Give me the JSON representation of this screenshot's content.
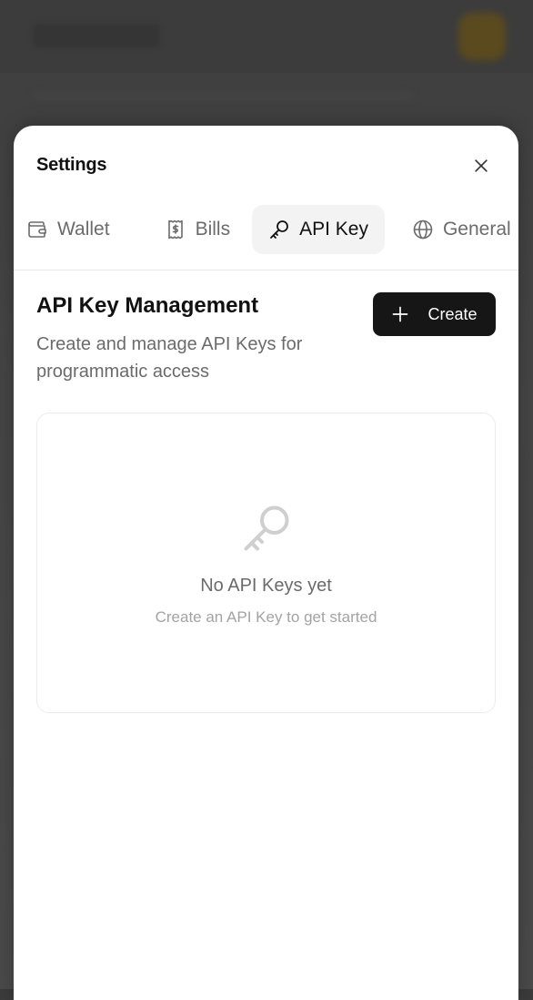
{
  "modal": {
    "title": "Settings"
  },
  "tabs": [
    {
      "label": "Wallet",
      "icon": "wallet-icon",
      "active": false
    },
    {
      "label": "Bills",
      "icon": "receipt-icon",
      "active": false
    },
    {
      "label": "API Key",
      "icon": "key-icon",
      "active": true
    },
    {
      "label": "General",
      "icon": "globe-icon",
      "active": false
    }
  ],
  "api_keys": {
    "title": "API Key Management",
    "description": "Create and manage API Keys for programmatic access",
    "create_label": "Create",
    "empty_title": "No API Keys yet",
    "empty_subtitle": "Create an API Key to get started"
  },
  "colors": {
    "primary_button": "#161616",
    "active_tab_bg": "#f3f3f3",
    "muted_text": "#6b6b6b",
    "placeholder_text": "#a3a3a3"
  }
}
